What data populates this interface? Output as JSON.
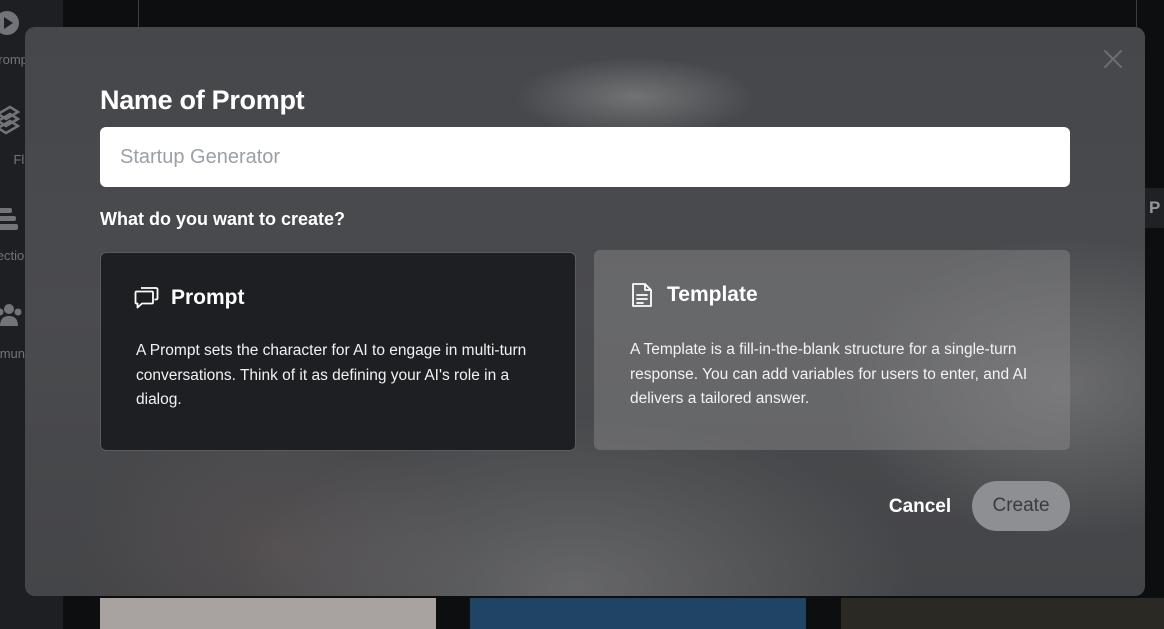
{
  "background": {
    "sidebar": {
      "items": [
        {
          "label": "Prompts",
          "icon": "play-circle-icon"
        },
        {
          "label": "Flux",
          "icon": "layers-icon"
        },
        {
          "label": "Collections",
          "icon": "stack-icon"
        },
        {
          "label": "Community",
          "icon": "people-icon"
        }
      ]
    },
    "right_tab_label": "P"
  },
  "modal": {
    "title": "Name of Prompt",
    "name_input": {
      "value": "",
      "placeholder": "Startup Generator"
    },
    "question": "What do you want to create?",
    "options": [
      {
        "title": "Prompt",
        "icon": "chat-bubbles-icon",
        "description": "A Prompt sets the character for AI to engage in multi-turn conversations. Think of it as defining your AI's role in a dialog.",
        "selected": true
      },
      {
        "title": "Template",
        "icon": "document-icon",
        "description": "A Template is a fill-in-the-blank structure for a single-turn response. You can add variables for users to enter, and AI delivers a tailored answer.",
        "selected": false
      }
    ],
    "cancel_label": "Cancel",
    "create_label": "Create",
    "close_icon": "close-icon"
  }
}
